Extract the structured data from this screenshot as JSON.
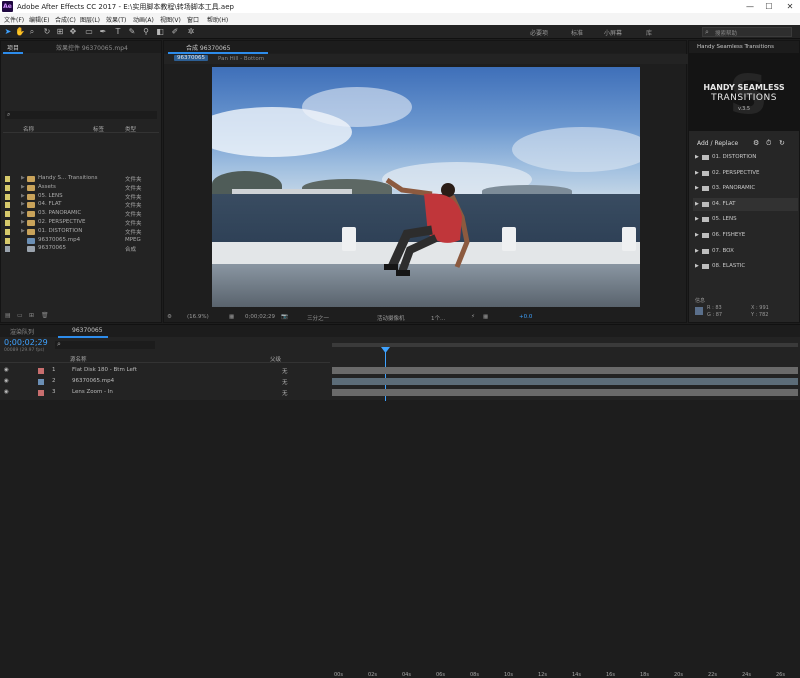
{
  "titlebar": {
    "app_letters": "Ae",
    "title": "Adobe After Effects CC 2017 - E:\\实用脚本教程\\转场脚本工具.aep",
    "min": "—",
    "max": "☐",
    "close": "✕"
  },
  "menu": [
    "文件(F)",
    "编辑(E)",
    "合成(C)",
    "图层(L)",
    "效果(T)",
    "动画(A)",
    "视图(V)",
    "窗口",
    "帮助(H)"
  ],
  "workspace": {
    "items": [
      "必要项",
      "标准",
      "小屏幕",
      "库"
    ],
    "search_placeholder": "搜索帮助"
  },
  "project": {
    "tabs": [
      "项目",
      "效果控件 96370065.mp4"
    ],
    "search_icon": "search-icon",
    "columns": {
      "name": "名称",
      "label": "标签",
      "type": "类型"
    },
    "rows": [
      {
        "name": "Handy S... Transitions",
        "type": "文件夹",
        "color": "#c9a35a",
        "kind": "folder"
      },
      {
        "name": "Assets",
        "type": "文件夹",
        "color": "#c9a35a",
        "kind": "folder"
      },
      {
        "name": "05. LENS",
        "type": "文件夹",
        "color": "#c9a35a",
        "kind": "folder"
      },
      {
        "name": "04. FLAT",
        "type": "文件夹",
        "color": "#c9a35a",
        "kind": "folder"
      },
      {
        "name": "03. PANORAMIC",
        "type": "文件夹",
        "color": "#c9a35a",
        "kind": "folder"
      },
      {
        "name": "02. PERSPECTIVE",
        "type": "文件夹",
        "color": "#c9a35a",
        "kind": "folder"
      },
      {
        "name": "01. DISTORTION",
        "type": "文件夹",
        "color": "#c9a35a",
        "kind": "folder"
      },
      {
        "name": "96370065.mp4",
        "type": "MPEG",
        "color": "#6b8fb5",
        "kind": "file"
      },
      {
        "name": "96370065",
        "type": "合成",
        "color": "#9aa3ad",
        "kind": "comp"
      }
    ]
  },
  "composition": {
    "tab": "合成 96370065",
    "breadcrumb": "96370065",
    "layer_tab": "Pan Hill - Bottom",
    "controls": {
      "zoom": "(16.9%)",
      "timecode": "0;00;02;29",
      "res": "三分之一",
      "camera": "活动摄像机",
      "views": "1个...",
      "exposure": "+0.0"
    }
  },
  "extension": {
    "header": "Handy Seamless Transitions",
    "logo_line1": "HANDY SEAMLESS",
    "logo_line2": "TRANSITIONS",
    "version": "v.3.5",
    "add_replace": "Add / Replace",
    "items": [
      "01. DISTORTION",
      "02. PERSPECTIVE",
      "03. PANORAMIC",
      "04. FLAT",
      "05. LENS",
      "06. FISHEYE",
      "07. BOX",
      "08. ELASTIC"
    ],
    "info_label": "信息",
    "info_values": {
      "r": "R : 83",
      "g": "G : 87",
      "x": "X : 991",
      "y": "Y : 782"
    }
  },
  "timeline": {
    "tabs": [
      "渲染队列",
      "96370065"
    ],
    "timecode": "0;00;02;29",
    "fps": "00089 (29.97 fps)",
    "columns": {
      "name": "源名称",
      "parent": "父级"
    },
    "ruler": [
      "00s",
      "02s",
      "04s",
      "06s",
      "08s",
      "10s",
      "12s",
      "14s",
      "16s",
      "18s",
      "20s",
      "22s",
      "24s",
      "26s"
    ],
    "layers": [
      {
        "num": "1",
        "name": "Flat Disk 180 - Btm Left",
        "parent": "无",
        "color": "#c86e6e"
      },
      {
        "num": "2",
        "name": "96370065.mp4",
        "parent": "无",
        "color": "#6b8fb5"
      },
      {
        "num": "3",
        "name": "Lens Zoom - In",
        "parent": "无",
        "color": "#c86e6e"
      }
    ]
  }
}
